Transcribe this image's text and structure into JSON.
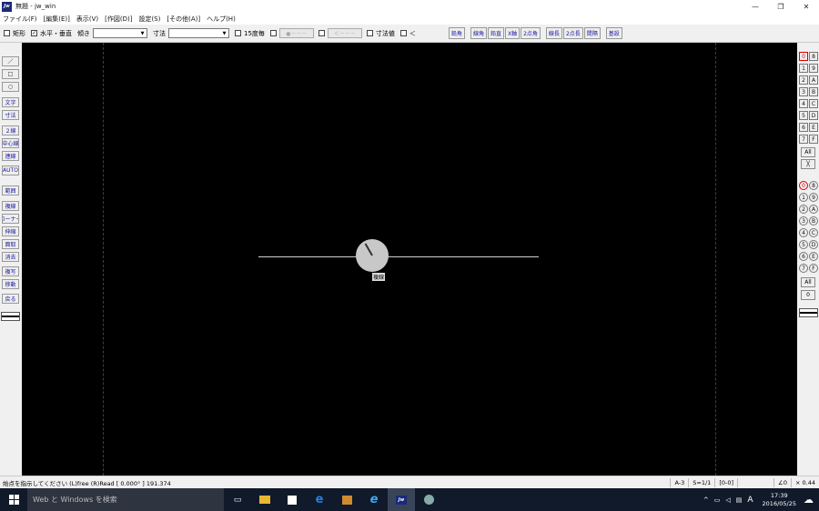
{
  "window": {
    "title": "無題 - jw_win",
    "app_icon_text": "Jw",
    "minimize": "—",
    "restore": "❐",
    "close": "✕"
  },
  "menu": [
    "ファイル(F)",
    "[編集(E)]",
    "表示(V)",
    "[作図(D)]",
    "設定(S)",
    "[その他(A)]",
    "ヘルプ(H)"
  ],
  "toolbar": {
    "rect_label": "矩形",
    "hv_label": "水平・垂直",
    "slope_label": "傾き",
    "dim_label": "寸法",
    "deg15_label": "15度毎",
    "btn_dot": "●－－－",
    "btn_arrow": "＜－－－",
    "dimvalue_label": "寸法値",
    "lt_label": "＜",
    "buttons": [
      "鉛角",
      "線角",
      "鉛直",
      "X軸",
      "2点角",
      "線長",
      "2点長",
      "間隔",
      "基設"
    ]
  },
  "left_tools": [
    "／",
    "□",
    "○",
    "文字",
    "寸法",
    "２線",
    "中心線",
    "連線",
    "AUTO",
    "範囲",
    "複線",
    "コーナー",
    "伸縮",
    "面取",
    "消去",
    "複写",
    "移動",
    "戻る"
  ],
  "right_layers": {
    "group_top": [
      "0",
      "8",
      "1",
      "9",
      "2",
      "A",
      "3",
      "B",
      "4",
      "C",
      "5",
      "D",
      "6",
      "E",
      "7",
      "F"
    ],
    "all1": "All",
    "x1": "╳",
    "group_bottom": [
      "0",
      "8",
      "1",
      "9",
      "2",
      "A",
      "3",
      "B",
      "4",
      "C",
      "5",
      "D",
      "6",
      "E",
      "7",
      "F"
    ],
    "all2": "All",
    "zero": "0"
  },
  "canvas": {
    "cursor_label": "複線"
  },
  "status": {
    "message": "始点を指示してください (L)free (R)Read  [ 0.000° ]  191.374",
    "paper": "A-3",
    "scale": "S=1/1",
    "layer": "[0-0]",
    "angle": "∠0",
    "zoom": "× 0.44"
  },
  "taskbar": {
    "search_placeholder": "Web と Windows を検索",
    "jw_label": "Jw",
    "ime": "A",
    "time": "17:39",
    "date": "2016/05/25"
  },
  "colors": {
    "canvas_bg": "#000000",
    "layer_selected": "#dd0000",
    "button_text": "#1a1aa0",
    "taskbar_bg": "#101a2a"
  }
}
